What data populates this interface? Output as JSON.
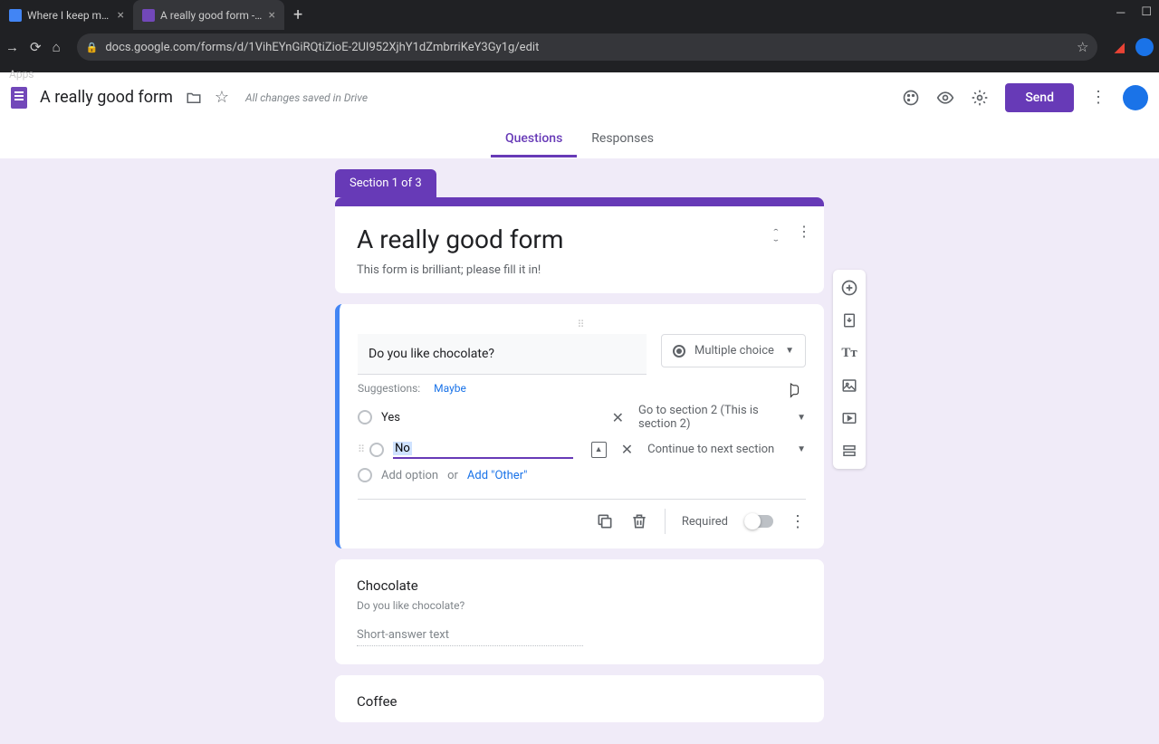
{
  "browser": {
    "tabs": [
      {
        "title": "Where I keep my Form - Google"
      },
      {
        "title": "A really good form - Google Form"
      }
    ],
    "url": "docs.google.com/forms/d/1VihEYnGiRQtiZioE-2UI952XjhY1dZmbrriKeY3Gy1g/edit",
    "bookmarks_label": "Apps"
  },
  "header": {
    "title": "A really good form",
    "save_status": "All changes saved in Drive",
    "send_label": "Send"
  },
  "tabs": {
    "questions": "Questions",
    "responses": "Responses"
  },
  "section_label": "Section 1 of 3",
  "form_header": {
    "title": "A really good form",
    "description": "This form is brilliant; please fill it in!"
  },
  "question1": {
    "title": "Do you like chocolate?",
    "type_label": "Multiple choice",
    "suggestions_label": "Suggestions:",
    "suggestion_chip": "Maybe",
    "options": [
      {
        "text": "Yes",
        "goto": "Go to section 2 (This is section 2)"
      },
      {
        "text": "No",
        "goto": "Continue to next section"
      }
    ],
    "add_option": "Add option",
    "or": "or",
    "add_other": "Add \"Other\"",
    "required_label": "Required"
  },
  "question2": {
    "title": "Chocolate",
    "subtitle": "Do you like chocolate?",
    "placeholder": "Short-answer text"
  },
  "question3": {
    "title": "Coffee"
  }
}
